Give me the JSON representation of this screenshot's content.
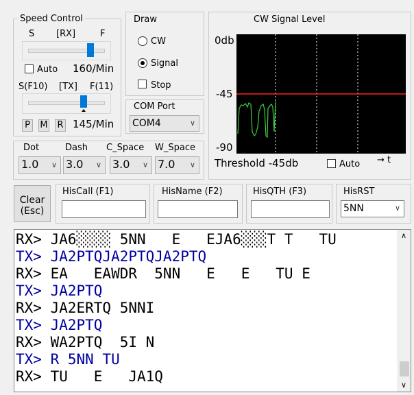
{
  "speed_control": {
    "title": "Speed Control",
    "rx_left": "S",
    "rx_center": "[RX]",
    "rx_right": "F",
    "auto_label": "Auto",
    "auto_checked": false,
    "rx_speed": "160/Min",
    "tx_left": "S(F10)",
    "tx_center": "[TX]",
    "tx_right": "F(11)",
    "btn_p": "P",
    "btn_m": "M",
    "btn_r": "R",
    "tx_speed": "145/Min"
  },
  "draw": {
    "title": "Draw",
    "cw_label": "CW",
    "signal_label": "Signal",
    "selected": "Signal",
    "stop_label": "Stop",
    "stop_checked": false
  },
  "com_port": {
    "title": "COM Port",
    "value": "COM4"
  },
  "signal_level": {
    "title": "CW Signal Level",
    "y_top": "0db",
    "y_mid": "-45",
    "y_bottom": "-90",
    "threshold_label": "Threshold -45db",
    "auto_label": "Auto",
    "auto_checked": false,
    "arrow_label": "→ t",
    "threshold_color": "#ff2020",
    "signal_color": "#40d040"
  },
  "timing": {
    "dot_label": "Dot",
    "dot_value": "1.0",
    "dash_label": "Dash",
    "dash_value": "3.0",
    "cspace_label": "C_Space",
    "cspace_value": "3.0",
    "wspace_label": "W_Space",
    "wspace_value": "7.0"
  },
  "clear_button": {
    "line1": "Clear",
    "line2": "(Esc)"
  },
  "his_fields": {
    "call_label": "HisCall (F1)",
    "call_value": "",
    "name_label": "HisName (F2)",
    "name_value": "",
    "qth_label": "HisQTH (F3)",
    "qth_value": "",
    "rst_label": "HisRST",
    "rst_value": "5NN"
  },
  "log": [
    {
      "type": "rx",
      "text": "RX> JA6░░░░ 5NN   E   EJA6░░░T T   TU"
    },
    {
      "type": "tx",
      "text": "TX> JA2PTQJA2PTQJA2PTQ"
    },
    {
      "type": "rx",
      "text": "RX> EA   EAWDR  5NN   E   E   TU E"
    },
    {
      "type": "tx",
      "text": "TX> JA2PTQ"
    },
    {
      "type": "rx",
      "text": "RX> JA2ERTQ 5NNI"
    },
    {
      "type": "tx",
      "text": "TX> JA2PTQ"
    },
    {
      "type": "rx",
      "text": "RX> WA2PTQ  5I N"
    },
    {
      "type": "tx",
      "text": "TX> R 5NN TU"
    },
    {
      "type": "rx",
      "text": "RX> TU   E   JA1Q"
    }
  ]
}
